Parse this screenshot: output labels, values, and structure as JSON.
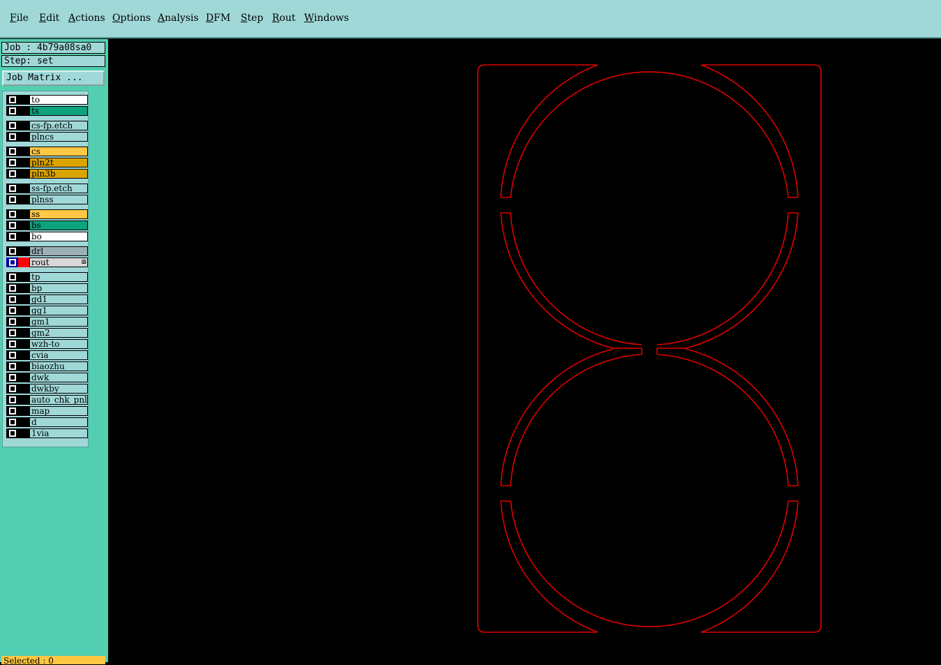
{
  "menu": [
    "File",
    "Edit",
    "Actions",
    "Options",
    "Analysis",
    "DFM",
    "Step",
    "Rout",
    "Windows"
  ],
  "job_label": "Job : 4b79a08sa0",
  "step_label": "Step: set",
  "job_matrix_button": "Job Matrix ...",
  "selected_label": "Selected : 0",
  "colors": {
    "menubar": "#a0d8d8",
    "sidebar": "#52cfb0",
    "rout_outline": "#e00000",
    "white_layer": "#ffffff",
    "green_layer": "#0ea37f",
    "yellow_layer": "#ffc844",
    "orange_layer": "#d9a400",
    "gray_layer": "#9aafb6",
    "light_layer": "#a0d8d8",
    "selected_layer": "#d8d8d8"
  },
  "layers": [
    {
      "name": "to",
      "color": "#ffffff"
    },
    {
      "name": "ts",
      "color": "#0ea37f"
    },
    {
      "name": "cs-fp.etch",
      "color": "#a0d8d8"
    },
    {
      "name": "plncs",
      "color": "#a0d8d8"
    },
    {
      "name": "cs",
      "color": "#ffc844"
    },
    {
      "name": "pln2t",
      "color": "#d9a400"
    },
    {
      "name": "pln3b",
      "color": "#d9a400"
    },
    {
      "name": "ss-fp.etch",
      "color": "#a0d8d8"
    },
    {
      "name": "plnss",
      "color": "#a0d8d8"
    },
    {
      "name": "ss",
      "color": "#ffc844"
    },
    {
      "name": "bs",
      "color": "#0ea37f"
    },
    {
      "name": "bo",
      "color": "#ffffff"
    },
    {
      "name": "drl",
      "color": "#9aafb6"
    },
    {
      "name": "rout",
      "color": "#d8d8d8",
      "selected": true
    },
    {
      "name": "tp",
      "color": "#a0d8d8"
    },
    {
      "name": "bp",
      "color": "#a0d8d8"
    },
    {
      "name": "gd1",
      "color": "#a0d8d8"
    },
    {
      "name": "gg1",
      "color": "#a0d8d8"
    },
    {
      "name": "gm1",
      "color": "#a0d8d8"
    },
    {
      "name": "gm2",
      "color": "#a0d8d8"
    },
    {
      "name": "wzh-to",
      "color": "#a0d8d8"
    },
    {
      "name": "cvia",
      "color": "#a0d8d8"
    },
    {
      "name": "biaozhu",
      "color": "#a0d8d8"
    },
    {
      "name": "dwk",
      "color": "#a0d8d8"
    },
    {
      "name": "dwkby",
      "color": "#a0d8d8"
    },
    {
      "name": "auto_chk_pnl",
      "color": "#a0d8d8"
    },
    {
      "name": "map",
      "color": "#a0d8d8"
    },
    {
      "name": "d",
      "color": "#a0d8d8"
    },
    {
      "name": "1via",
      "color": "#a0d8d8"
    }
  ]
}
